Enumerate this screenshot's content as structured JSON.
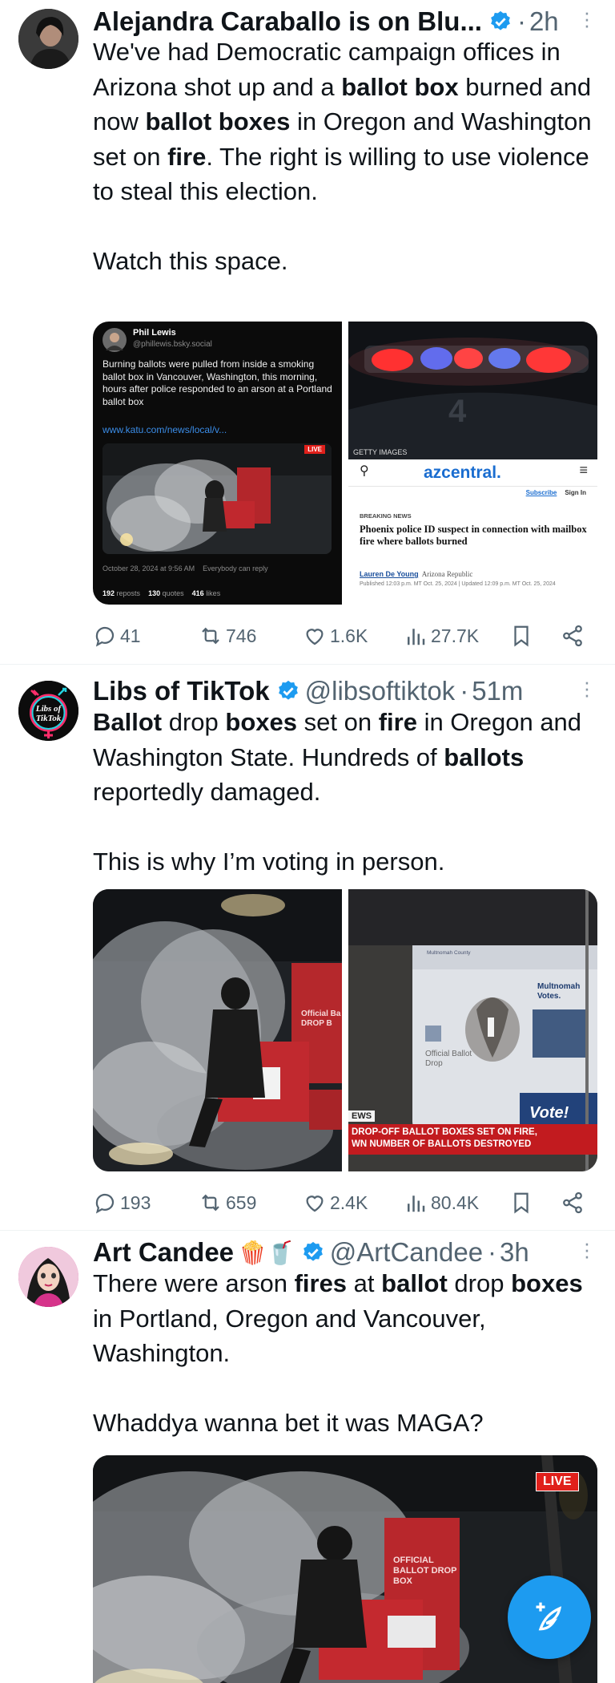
{
  "tweets": [
    {
      "name": "Alejandra Caraballo is on Blu...",
      "time_sep": "·",
      "time": "2h",
      "text_parts": [
        {
          "t": "We've had Democratic campaign offices in Arizona shot up and a "
        },
        {
          "t": "ballot box",
          "b": true
        },
        {
          "t": " burned and now "
        },
        {
          "t": "ballot boxes",
          "b": true
        },
        {
          "t": " in Oregon and Washington set on "
        },
        {
          "t": "fire",
          "b": true
        },
        {
          "t": ". The right is willing to use violence to steal this election."
        }
      ],
      "text_second": "Watch this space.",
      "embedded_post": {
        "author": "Phil Lewis",
        "handle": "@phillewis.bsky.social",
        "text": "Burning ballots were pulled from inside a smoking ballot box in Vancouver, Washington, this morning, hours after police responded to an arson at a Portland ballot box",
        "link": "www.katu.com/news/local/v...",
        "live": "LIVE",
        "date": "October 28, 2024 at 9:56 AM",
        "reply": "Everybody can reply",
        "reposts_num": "192",
        "reposts_label": "reposts",
        "quotes_num": "130",
        "quotes_label": "quotes",
        "likes_num": "416",
        "likes_label": "likes"
      },
      "news_card": {
        "credit": "GETTY IMAGES",
        "brand": "azcentral.",
        "subscribe": "Subscribe",
        "signin": "Sign In",
        "kicker": "BREAKING NEWS",
        "headline": "Phoenix police ID suspect in connection with mailbox fire where ballots burned",
        "author": "Lauren De Young",
        "outlet": "Arizona Republic",
        "published": "Published 12:03 p.m. MT Oct. 25, 2024 | Updated 12:09 p.m. MT Oct. 25, 2024"
      },
      "stats": {
        "replies": "41",
        "reposts": "746",
        "likes": "1.6K",
        "views": "27.7K"
      }
    },
    {
      "name": "Libs of TikTok",
      "handle": "@libsoftiktok",
      "time_sep": "·",
      "time": "51m",
      "avatar_text": "Libs of TikTok",
      "text_parts": [
        {
          "t": "Ballot",
          "b": true
        },
        {
          "t": " drop "
        },
        {
          "t": "boxes",
          "b": true
        },
        {
          "t": " set on "
        },
        {
          "t": "fire",
          "b": true
        },
        {
          "t": " in Oregon and Washington State. Hundreds of "
        },
        {
          "t": "ballots",
          "b": true
        },
        {
          "t": " reportedly damaged."
        }
      ],
      "text_second": "This is why I’m voting in person.",
      "left_box_label": "Official Ba DROP B",
      "right_card": {
        "county": "Multnomah County",
        "brand": "Multnomah Votes.",
        "box_label": "Official Ballot Drop",
        "vote": "Vote!",
        "tag": "EWS",
        "headline1": "DROP-OFF BALLOT BOXES SET ON FIRE,",
        "headline2": "WN NUMBER OF BALLOTS DESTROYED"
      },
      "stats": {
        "replies": "193",
        "reposts": "659",
        "likes": "2.4K",
        "views": "80.4K"
      }
    },
    {
      "name": "Art Candee",
      "emoji": "🍿🥤",
      "handle": "@ArtCandee",
      "time_sep": "·",
      "time": "3h",
      "text_parts": [
        {
          "t": "There were arson "
        },
        {
          "t": "fires",
          "b": true
        },
        {
          "t": " at "
        },
        {
          "t": "ballot",
          "b": true
        },
        {
          "t": " drop "
        },
        {
          "t": "boxes",
          "b": true
        },
        {
          "t": " in Portland, Oregon and Vancouver, Washington."
        }
      ],
      "text_second": "Whaddya wanna bet it was MAGA?",
      "live": "LIVE",
      "box_label": "OFFICIAL BALLOT DROP BOX"
    }
  ],
  "colors": {
    "verified": "#1d9bf0",
    "fab": "#1d9bf0",
    "muted": "#536471",
    "live_red": "#e0201b"
  },
  "icons": [
    "verified-badge-icon",
    "more-icon",
    "reply-icon",
    "repost-icon",
    "like-icon",
    "views-icon",
    "bookmark-icon",
    "share-icon",
    "compose-post-icon"
  ]
}
